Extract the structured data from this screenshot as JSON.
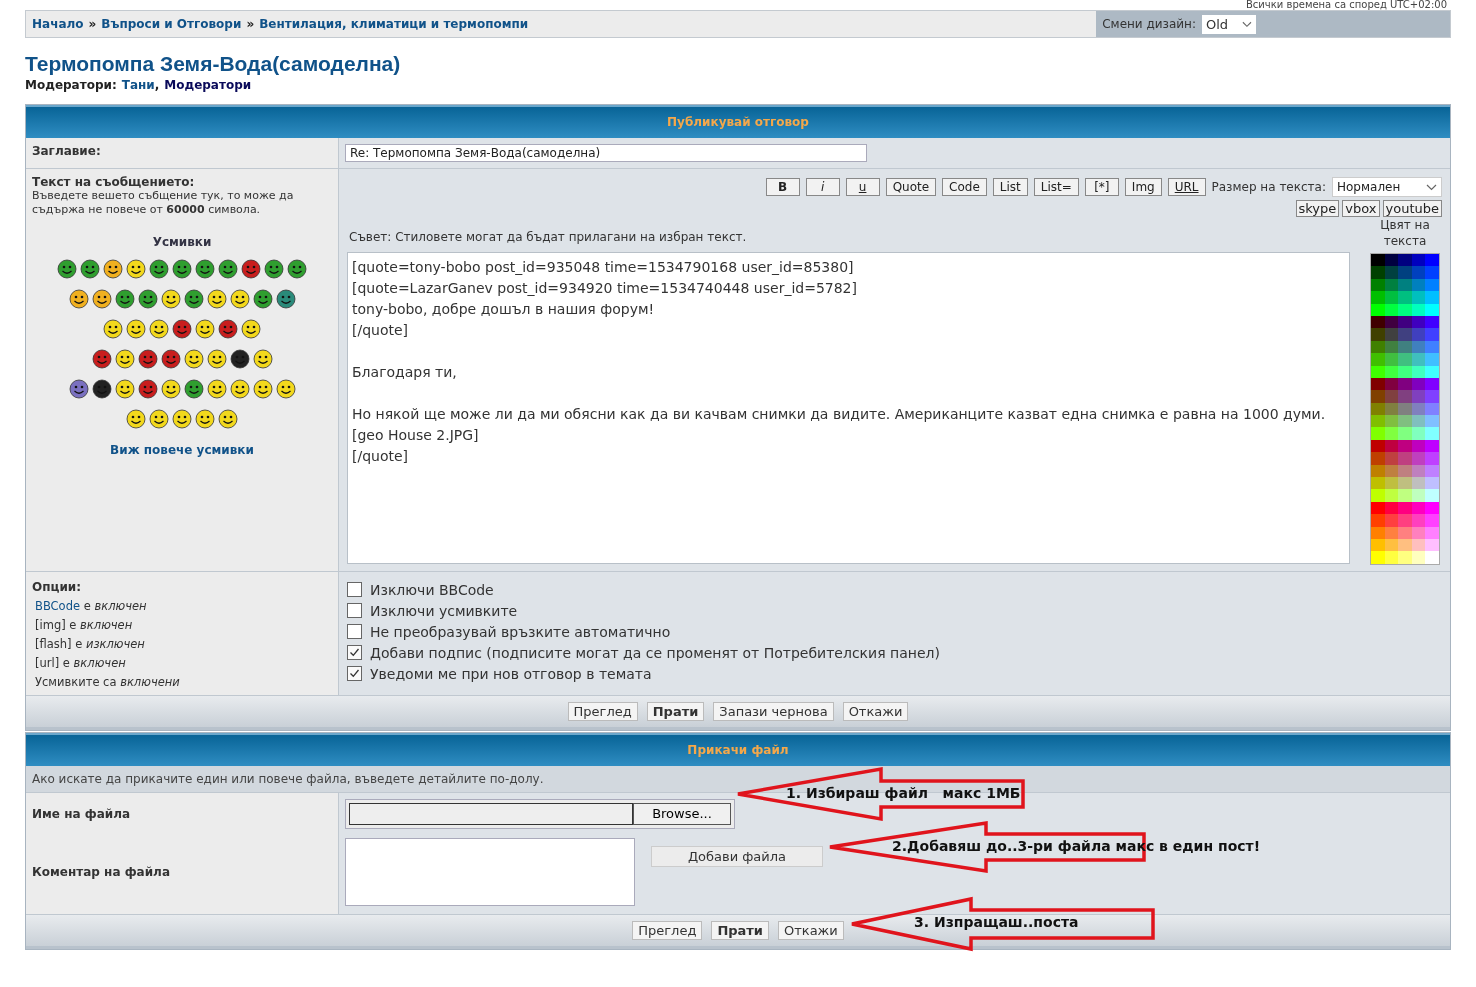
{
  "timezone_note": "Всички времена са според UTC+02:00",
  "breadcrumb": {
    "separator": "»",
    "items": [
      "Начало",
      "Въпроси и Отговори",
      "Вентилация, климатици и термопомпи"
    ]
  },
  "design_switch": {
    "label": "Смени дизайн:",
    "value": "Old"
  },
  "topic_title": "Термопомпа Земя-Вода(самоделна)",
  "moderators": {
    "label": "Модератори:",
    "separator": ",",
    "names": [
      {
        "name": "Тани",
        "kind": "user"
      },
      {
        "name": "Модератори",
        "kind": "group"
      }
    ]
  },
  "reply_form": {
    "header": "Публикувай отговор",
    "subject_label": "Заглавие:",
    "subject_value": "Re: Термопомпа Земя-Вода(самоделна)",
    "message_label": "Текст на съобщението:",
    "message_hint": "Въведете вешето събщение тук, то може да съдържа не повече от **60000** символа.",
    "smilies_title": "Усмивки",
    "more_smilies": "Виж повече усмивки",
    "format_buttons": [
      {
        "label": "B",
        "kind": "bold"
      },
      {
        "label": "i",
        "kind": "italic"
      },
      {
        "label": "u",
        "kind": "underline"
      },
      {
        "label": "Quote",
        "kind": "plain"
      },
      {
        "label": "Code",
        "kind": "plain"
      },
      {
        "label": "List",
        "kind": "plain"
      },
      {
        "label": "List=",
        "kind": "plain"
      },
      {
        "label": "[*]",
        "kind": "plain"
      },
      {
        "label": "Img",
        "kind": "plain"
      },
      {
        "label": "URL",
        "kind": "underline"
      }
    ],
    "size_label": "Размер на текста:",
    "size_value": "Нормален",
    "extra_buttons": [
      "skype",
      "vbox",
      "youtube"
    ],
    "tip": "Съвет: Стиловете могат да бъдат прилагани на избран текст.",
    "color_label": "Цвят на текста",
    "message_text": "[quote=tony-bobo post_id=935048 time=1534790168 user_id=85380]\n[quote=LazarGanev post_id=934920 time=1534740448 user_id=5782]\ntony-bobo, добре дошъл в нашия форум!\n[/quote]\n\nБлагодаря ти,\n\nНо някой ще може ли да ми обясни как да ви качвам снимки да видите. Американците казват една снимка е равна на 1000 думи.[geo House 2.JPG]\n[/quote]",
    "options_title": "Опции:",
    "option_status": [
      {
        "link": "BBCode",
        "text": " е *включен*"
      },
      {
        "text": "[img] е *включен*"
      },
      {
        "text": "[flash] е *изключен*"
      },
      {
        "text": "[url] е *включен*"
      },
      {
        "text": "Усмивките са *включени*"
      }
    ],
    "checkboxes": [
      {
        "label": "Изключи BBCode",
        "checked": false
      },
      {
        "label": "Изключи усмивките",
        "checked": false
      },
      {
        "label": "Не преобразувай връзките автоматично",
        "checked": false
      },
      {
        "label": "Добави подпис (подписите могат да се променят от Потребителския панел)",
        "checked": true
      },
      {
        "label": "Уведоми ме при нов отговор в темата",
        "checked": true
      }
    ],
    "buttons": [
      {
        "label": "Преглед",
        "primary": false
      },
      {
        "label": "Прати",
        "primary": true
      },
      {
        "label": "Запази чернова",
        "primary": false
      },
      {
        "label": "Откажи",
        "primary": false
      }
    ]
  },
  "attach_form": {
    "header": "Прикачи файл",
    "hint": "Ако искате да прикачите един или повече файла, въведете детайлите по-долу.",
    "filename_label": "Име на файла",
    "browse": "Browse...",
    "comment_label": "Коментар на файла",
    "add_button": "Добави файла",
    "buttons": [
      {
        "label": "Преглед",
        "primary": false
      },
      {
        "label": "Прати",
        "primary": true
      },
      {
        "label": "Откажи",
        "primary": false
      }
    ]
  },
  "annotations": [
    "1. Избираш файл   макс 1МБ",
    "2.Добавяш до..3-ри файла макс в един пост!",
    "3. Изпращаш..поста"
  ]
}
